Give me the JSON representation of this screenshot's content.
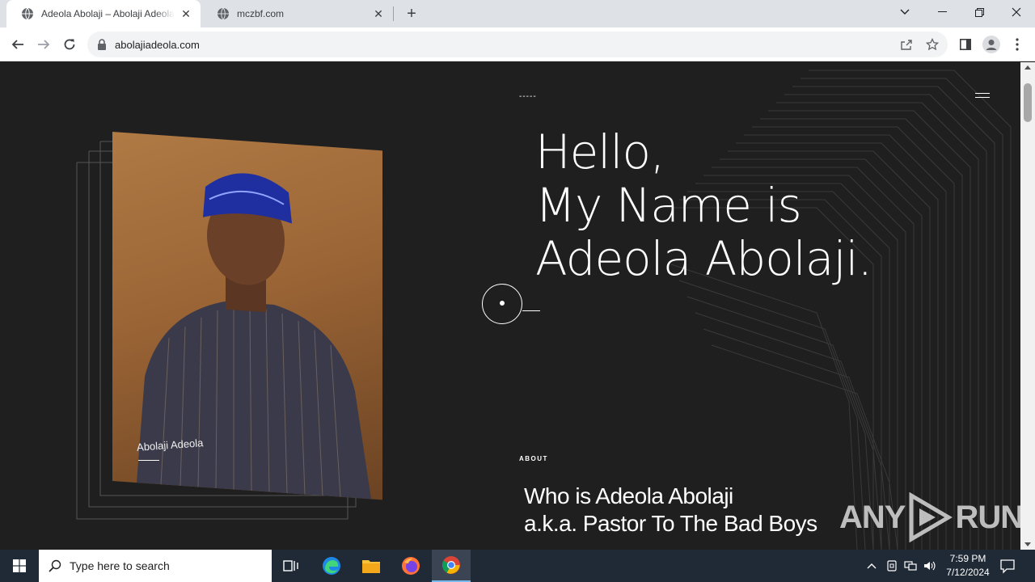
{
  "browser": {
    "tabs": [
      {
        "title": "Adeola Abolaji – Abolaji Adeola (Pastor To The Bad Boys)",
        "active": true
      },
      {
        "title": "mczbf.com",
        "active": false
      }
    ],
    "address": "abolajiadeola.com"
  },
  "page": {
    "dash_label": "-----",
    "hero_lines": [
      "Hello,",
      "My Name is",
      "Adeola Abolaji."
    ],
    "photo_caption": "Abolaji Adeola",
    "about_label": "ABOUT",
    "about_title_lines": [
      "Who is Adeola Abolaji",
      "a.k.a. Pastor To The Bad Boys"
    ]
  },
  "watermark": {
    "left": "ANY",
    "right": "RUN"
  },
  "taskbar": {
    "search_placeholder": "Type here to search",
    "time": "7:59 PM",
    "date": "7/12/2024"
  },
  "colors": {
    "page_bg": "#1f1f1f",
    "taskbar_bg": "#202a36",
    "tab_strip_bg": "#dee1e6"
  }
}
